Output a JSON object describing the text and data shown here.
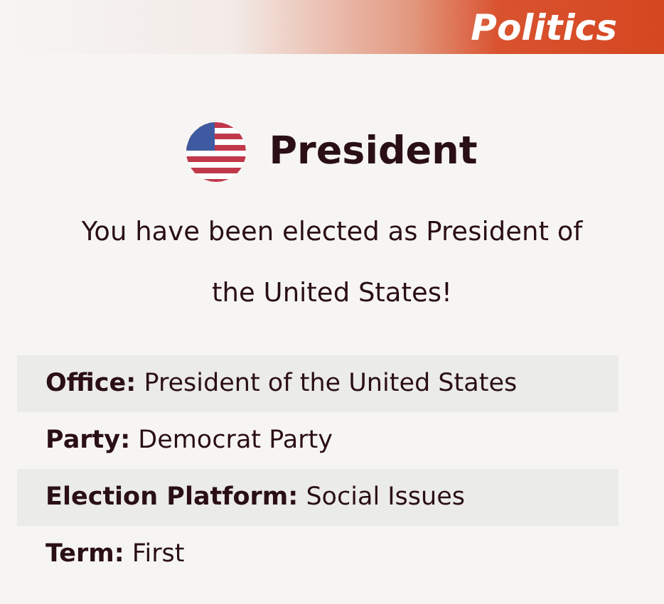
{
  "header": {
    "category": "Politics"
  },
  "title": "President",
  "message": "You have been elected as President of the United States!",
  "details": [
    {
      "text": "**Office:** President of the United States"
    },
    {
      "text": "**Party:** Democrat Party"
    },
    {
      "text": "**Election Platform:** Social Issues"
    },
    {
      "text": "**Term:** First"
    }
  ]
}
